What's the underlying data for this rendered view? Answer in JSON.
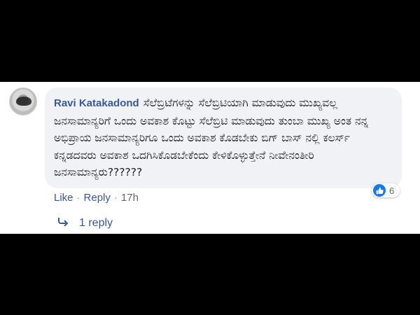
{
  "comment": {
    "author": "Ravi Katakadond",
    "text": "ಸೆಲೆಬ್ರಿಟೆಗಳನ್ನು ಸೆಲೆಬ್ರಿಟಿಯಾಗಿ ಮಾಡುವುದು ಮುಖ್ಯವಲ್ಲ ಜನಸಾಮಾನ್ಯರಿಗೆ ಒಂದು ಅವಕಾಶ ಕೊಟ್ಟು ಸೆಲೆಬ್ರಿಟಿ ಮಾಡುವುದು ತುಂಬಾ ಮುಖ್ಯ ಅಂತ ನನ್ನ ಅಭಿಪ್ರಾಯ ಜನಸಾಮಾನ್ಯರಿಗೂ ಒಂದು ಅವಕಾಶ ಕೊಡಬೇಕು ಬಿಗ್ ಬಾಸ್ ನಲ್ಲಿ ಕಲರ್ಸ್ ಕನ್ನಡದವರು ಅವಕಾಶ ಒದಗಿಸಿಕೊಡಬೇಕೆಂದು ಕೇಳಿಕೊಳ್ಳುತ್ತೇನೆ ನೀವೇನಂತೀರಿ ಜನಸಾಮಾನ್ಯರು??????",
    "reaction_icon": "like-icon",
    "reaction_count": "6"
  },
  "actions": {
    "like_label": "Like",
    "separator": "·",
    "reply_label": "Reply",
    "time": "17h"
  },
  "replies": {
    "icon": "reply-arrow-icon",
    "label": "1 reply"
  },
  "colors": {
    "name_blue": "#385898",
    "bubble_bg": "#f0f2f5",
    "meta_gray": "#65676b",
    "like_blue": "#1877f2"
  }
}
